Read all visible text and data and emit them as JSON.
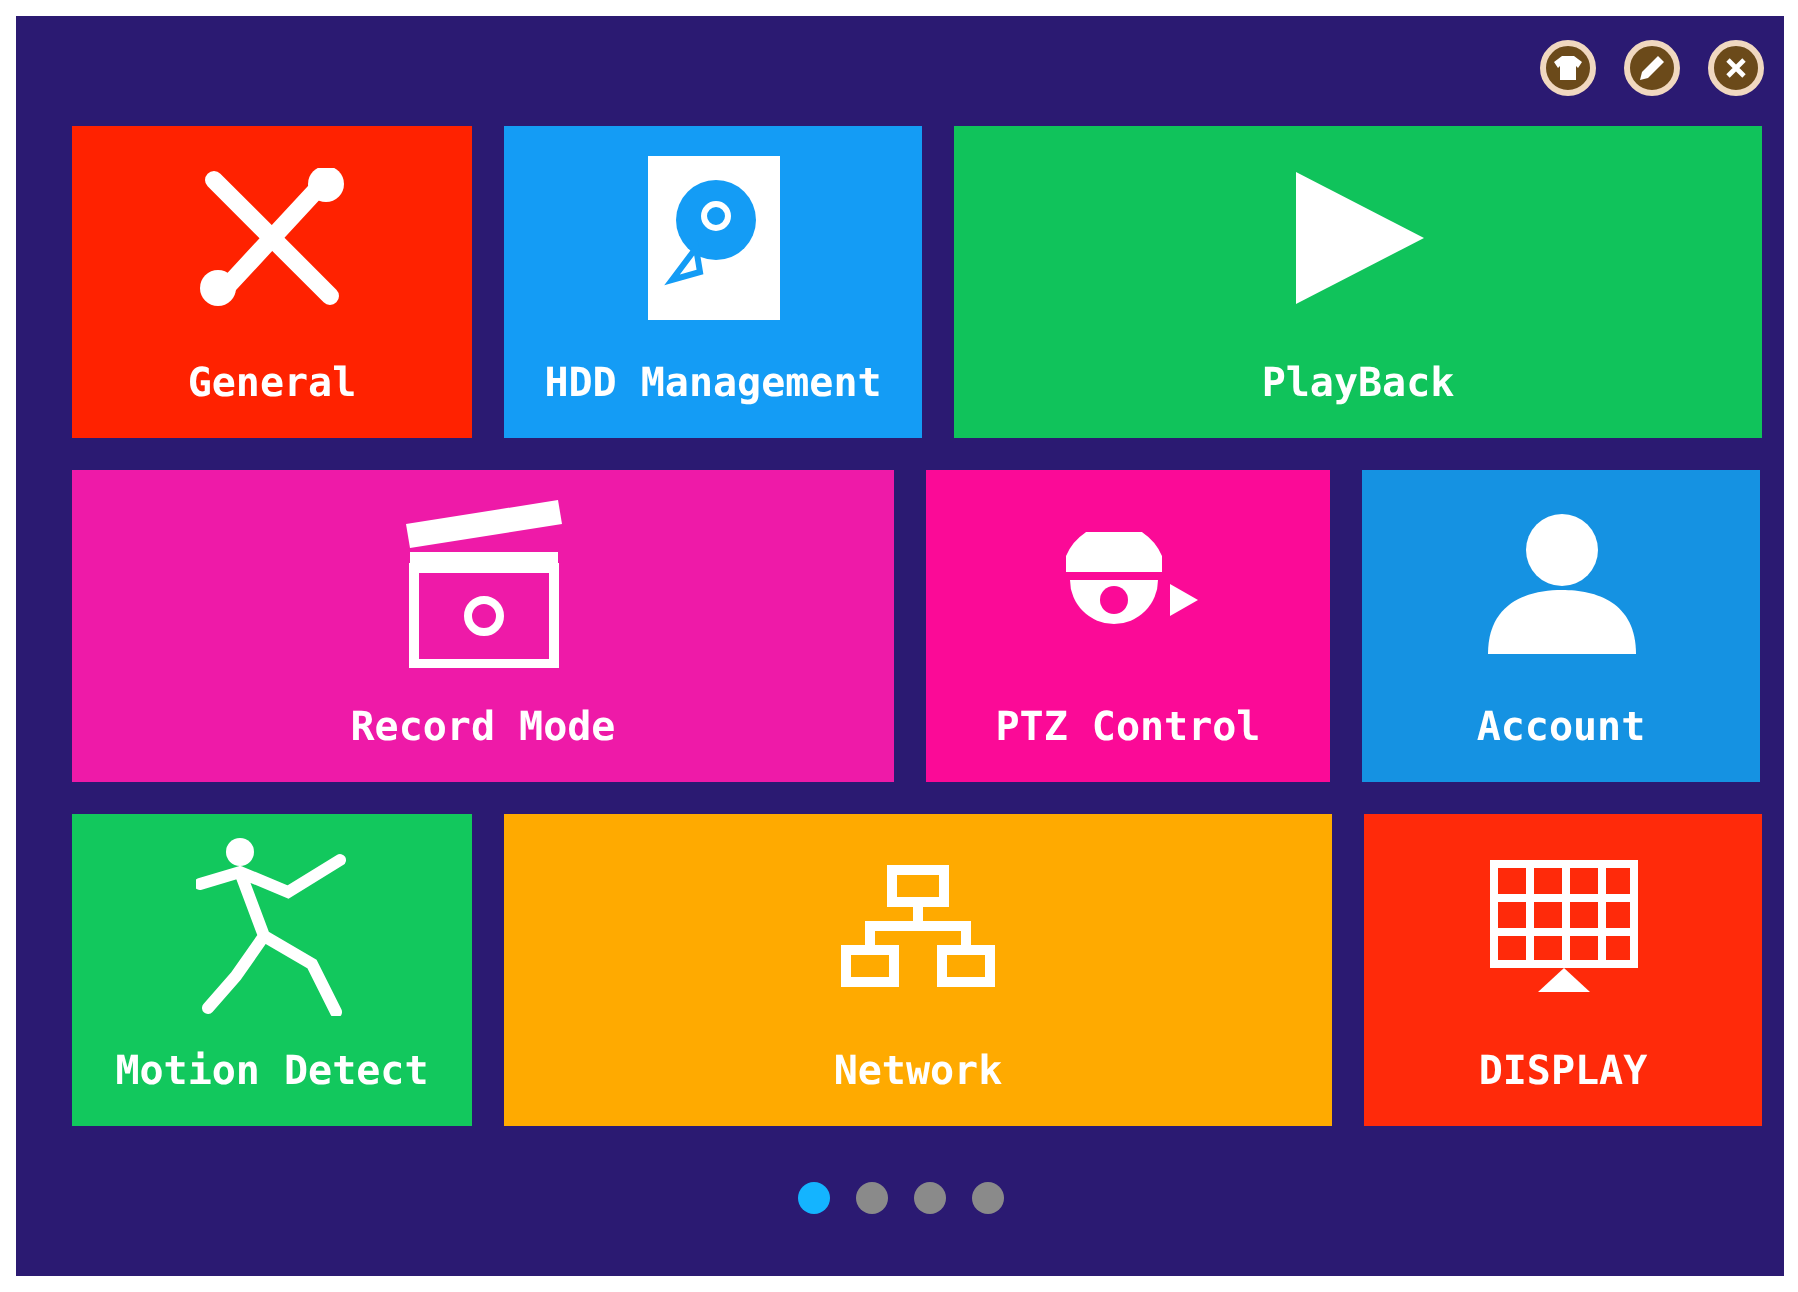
{
  "header_buttons": [
    {
      "kind": "shirt"
    },
    {
      "kind": "pencil"
    },
    {
      "kind": "close"
    }
  ],
  "rows": [
    [
      {
        "label": "General",
        "kind": "tools",
        "color": "#ff2200"
      },
      {
        "label": "HDD Management",
        "kind": "hdd",
        "color": "#149cf5"
      },
      {
        "label": "PlayBack",
        "kind": "play",
        "color": "#10c35b"
      }
    ],
    [
      {
        "label": "Record Mode",
        "kind": "clapper",
        "color": "#ee1aa8"
      },
      {
        "label": "PTZ Control",
        "kind": "camera",
        "color": "#fb0a97"
      },
      {
        "label": "Account",
        "kind": "user",
        "color": "#1592e2"
      }
    ],
    [
      {
        "label": "Motion Detect",
        "kind": "runner",
        "color": "#12c85d"
      },
      {
        "label": "Network",
        "kind": "network",
        "color": "#ffaa00"
      },
      {
        "label": "DISPLAY",
        "kind": "grid",
        "color": "#ff2a0a"
      }
    ]
  ],
  "pages": [
    {
      "selected": true
    },
    {
      "selected": false
    },
    {
      "selected": false
    },
    {
      "selected": false
    }
  ]
}
